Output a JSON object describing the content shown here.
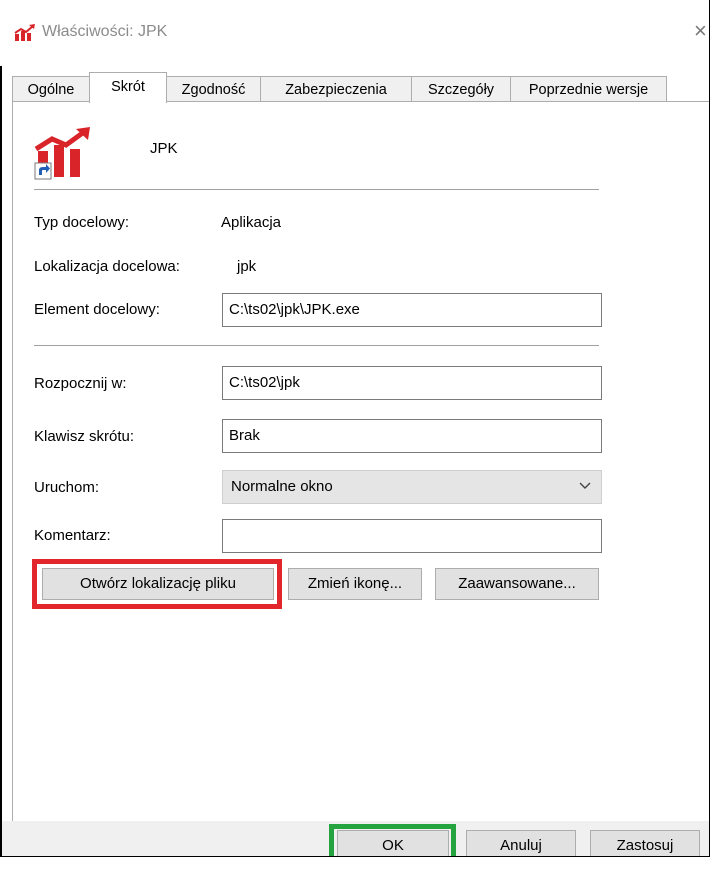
{
  "window": {
    "title": "Właściwości: JPK",
    "close_glyph": "×"
  },
  "tabs": [
    {
      "label": "Ogólne",
      "active": false
    },
    {
      "label": "Skrót",
      "active": true
    },
    {
      "label": "Zgodność",
      "active": false
    },
    {
      "label": "Zabezpieczenia",
      "active": false
    },
    {
      "label": "Szczegóły",
      "active": false
    },
    {
      "label": "Poprzednie wersje",
      "active": false
    }
  ],
  "shortcut": {
    "name": "JPK",
    "target_type_label": "Typ docelowy:",
    "target_type_value": "Aplikacja",
    "target_location_label": "Lokalizacja docelowa:",
    "target_location_value": "jpk",
    "target_label": "Element docelowy:",
    "target_value": "C:\\ts02\\jpk\\JPK.exe",
    "start_in_label": "Rozpocznij w:",
    "start_in_value": "C:\\ts02\\jpk",
    "hotkey_label": "Klawisz skrótu:",
    "hotkey_value": "Brak",
    "run_label": "Uruchom:",
    "run_value": "Normalne okno",
    "comment_label": "Komentarz:",
    "comment_value": ""
  },
  "buttons": {
    "open_location": "Otwórz lokalizację pliku",
    "change_icon": "Zmień ikonę...",
    "advanced": "Zaawansowane...",
    "ok": "OK",
    "cancel": "Anuluj",
    "apply": "Zastosuj"
  },
  "colors": {
    "highlight_red": "#e3262b",
    "highlight_green": "#25a33e",
    "icon_red": "#d9242a"
  },
  "icons": {
    "app": "chart-up-arrow-icon",
    "shortcut_overlay": "shortcut-arrow-icon",
    "dropdown": "chevron-down-icon"
  }
}
